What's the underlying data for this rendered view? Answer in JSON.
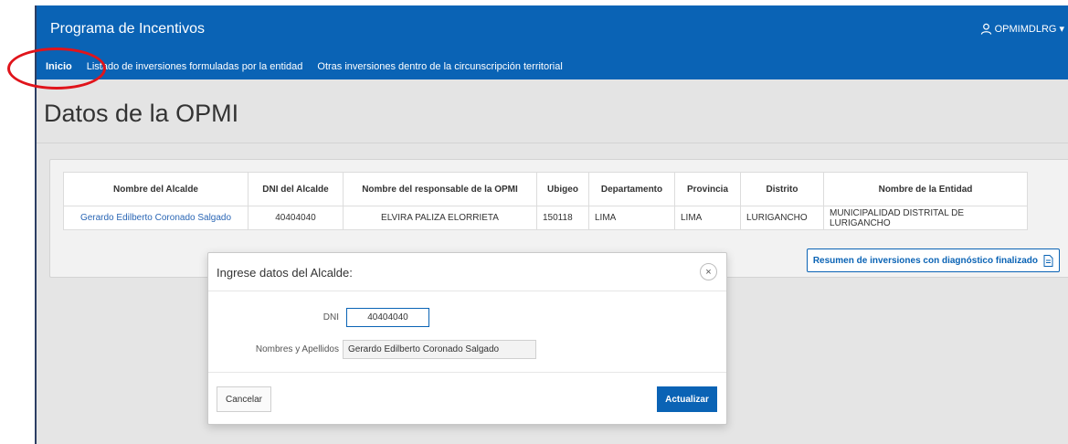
{
  "app": {
    "title": "Programa de Incentivos",
    "user": "OPMIMDLRG"
  },
  "nav": {
    "items": [
      {
        "label": "Inicio"
      },
      {
        "label": "Listado de inversiones formuladas por la entidad"
      },
      {
        "label": "Otras inversiones dentro de la circunscripción territorial"
      }
    ]
  },
  "page": {
    "title": "Datos de la OPMI"
  },
  "table": {
    "headers": [
      "Nombre del Alcalde",
      "DNI del Alcalde",
      "Nombre del responsable de la OPMI",
      "Ubigeo",
      "Departamento",
      "Provincia",
      "Distrito",
      "Nombre de la Entidad"
    ],
    "row": [
      "Gerardo Edilberto Coronado Salgado",
      "40404040",
      "ELVIRA PALIZA ELORRIETA",
      "150118",
      "LIMA",
      "LIMA",
      "LURIGANCHO",
      "MUNICIPALIDAD DISTRITAL DE LURIGANCHO"
    ]
  },
  "summary_button": {
    "label": "Resumen de inversiones con diagnóstico finalizado"
  },
  "dialog": {
    "title": "Ingrese datos del Alcalde:",
    "close_glyph": "×",
    "dni_label": "DNI",
    "dni_value": "40404040",
    "name_label": "Nombres y Apellidos",
    "name_value": "Gerardo Edilberto Coronado Salgado",
    "cancel_label": "Cancelar",
    "update_label": "Actualizar"
  },
  "colors": {
    "brand": "#0a63b5",
    "annotation": "#e0141b"
  }
}
